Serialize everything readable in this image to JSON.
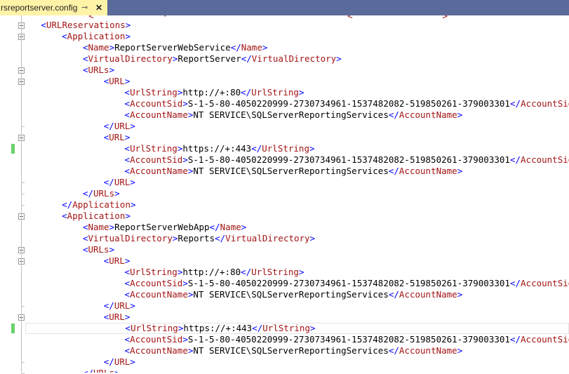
{
  "tab": {
    "title": "rsreportserver.config",
    "pin_glyph": "⊸",
    "close_glyph": "✕"
  },
  "colors": {
    "bracket": "#0000ff",
    "tag_name": "#a31515",
    "text": "#000000",
    "change_marker": "#6bd16b",
    "tab_active": "#fff3a8",
    "tab_bar": "#5a6a9a"
  },
  "editor": {
    "partial_top_line": "            <             ·                                  <                 >",
    "lines": [
      {
        "indent": 1,
        "tag": "URLReservations",
        "kind": "open"
      },
      {
        "indent": 2,
        "tag": "Application",
        "kind": "open"
      },
      {
        "indent": 3,
        "tag": "Name",
        "kind": "leaf",
        "value": "ReportServerWebService"
      },
      {
        "indent": 3,
        "tag": "VirtualDirectory",
        "kind": "leaf",
        "value": "ReportServer"
      },
      {
        "indent": 3,
        "tag": "URLs",
        "kind": "open"
      },
      {
        "indent": 4,
        "tag": "URL",
        "kind": "open"
      },
      {
        "indent": 5,
        "tag": "UrlString",
        "kind": "leaf",
        "value": "http://+:80"
      },
      {
        "indent": 5,
        "tag": "AccountSid",
        "kind": "leaf",
        "value": "S-1-5-80-4050220999-2730734961-1537482082-519850261-379003301"
      },
      {
        "indent": 5,
        "tag": "AccountName",
        "kind": "leaf",
        "value": "NT SERVICE\\SQLServerReportingServices"
      },
      {
        "indent": 4,
        "tag": "URL",
        "kind": "close"
      },
      {
        "indent": 4,
        "tag": "URL",
        "kind": "open"
      },
      {
        "indent": 5,
        "tag": "UrlString",
        "kind": "leaf",
        "value": "https://+:443",
        "changed": true
      },
      {
        "indent": 5,
        "tag": "AccountSid",
        "kind": "leaf",
        "value": "S-1-5-80-4050220999-2730734961-1537482082-519850261-379003301"
      },
      {
        "indent": 5,
        "tag": "AccountName",
        "kind": "leaf",
        "value": "NT SERVICE\\SQLServerReportingServices"
      },
      {
        "indent": 4,
        "tag": "URL",
        "kind": "close"
      },
      {
        "indent": 3,
        "tag": "URLs",
        "kind": "close"
      },
      {
        "indent": 2,
        "tag": "Application",
        "kind": "close"
      },
      {
        "indent": 2,
        "tag": "Application",
        "kind": "open"
      },
      {
        "indent": 3,
        "tag": "Name",
        "kind": "leaf",
        "value": "ReportServerWebApp"
      },
      {
        "indent": 3,
        "tag": "VirtualDirectory",
        "kind": "leaf",
        "value": "Reports"
      },
      {
        "indent": 3,
        "tag": "URLs",
        "kind": "open"
      },
      {
        "indent": 4,
        "tag": "URL",
        "kind": "open"
      },
      {
        "indent": 5,
        "tag": "UrlString",
        "kind": "leaf",
        "value": "http://+:80"
      },
      {
        "indent": 5,
        "tag": "AccountSid",
        "kind": "leaf",
        "value": "S-1-5-80-4050220999-2730734961-1537482082-519850261-379003301"
      },
      {
        "indent": 5,
        "tag": "AccountName",
        "kind": "leaf",
        "value": "NT SERVICE\\SQLServerReportingServices"
      },
      {
        "indent": 4,
        "tag": "URL",
        "kind": "close"
      },
      {
        "indent": 4,
        "tag": "URL",
        "kind": "open"
      },
      {
        "indent": 5,
        "tag": "UrlString",
        "kind": "leaf",
        "value": "https://+:443",
        "changed": true,
        "current": true
      },
      {
        "indent": 5,
        "tag": "AccountSid",
        "kind": "leaf",
        "value": "S-1-5-80-4050220999-2730734961-1537482082-519850261-379003301"
      },
      {
        "indent": 5,
        "tag": "AccountName",
        "kind": "leaf",
        "value": "NT SERVICE\\SQLServerReportingServices"
      },
      {
        "indent": 4,
        "tag": "URL",
        "kind": "close"
      },
      {
        "indent": 3,
        "tag": "URLs",
        "kind": "close"
      }
    ]
  }
}
